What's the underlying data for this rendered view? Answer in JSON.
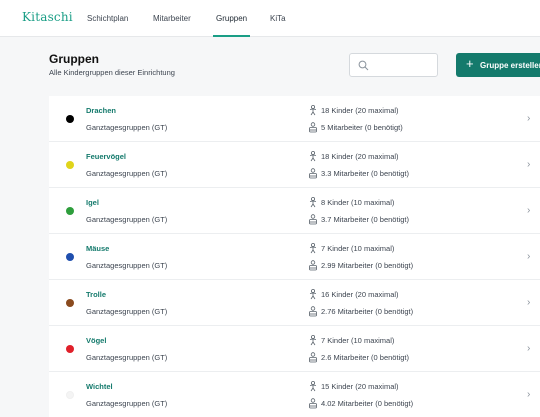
{
  "app": {
    "logo": "Kitaschi"
  },
  "nav": [
    {
      "label": "Schichtplan",
      "active": false
    },
    {
      "label": "Mitarbeiter",
      "active": false
    },
    {
      "label": "Gruppen",
      "active": true
    },
    {
      "label": "KiTa",
      "active": false
    }
  ],
  "header": {
    "title": "Gruppen",
    "subtitle": "Alle Kindergruppen dieser Einrichtung",
    "search_placeholder": "",
    "create_plus": "+",
    "create_label": "Gruppe erstellen"
  },
  "colors": {
    "accent": "#1a9e86",
    "button": "#147a6c"
  },
  "groups": [
    {
      "name": "Drachen",
      "type": "Ganztagesgruppen (GT)",
      "kids": "18 Kinder  (20 maximal)",
      "staff": "5 Mitarbeiter (0 benötigt)",
      "color": "#000000"
    },
    {
      "name": "Feuervögel",
      "type": "Ganztagesgruppen (GT)",
      "kids": "18 Kinder  (20 maximal)",
      "staff": "3.3 Mitarbeiter (0 benötigt)",
      "color": "#e0d41a"
    },
    {
      "name": "Igel",
      "type": "Ganztagesgruppen (GT)",
      "kids": "8 Kinder  (10 maximal)",
      "staff": "3.7 Mitarbeiter (0 benötigt)",
      "color": "#2e9e3c"
    },
    {
      "name": "Mäuse",
      "type": "Ganztagesgruppen (GT)",
      "kids": "7 Kinder  (10 maximal)",
      "staff": "2.99 Mitarbeiter (0 benötigt)",
      "color": "#1f4fae"
    },
    {
      "name": "Trolle",
      "type": "Ganztagesgruppen (GT)",
      "kids": "16 Kinder  (20 maximal)",
      "staff": "2.76 Mitarbeiter (0 benötigt)",
      "color": "#8a4a1e"
    },
    {
      "name": "Vögel",
      "type": "Ganztagesgruppen (GT)",
      "kids": "7 Kinder  (10 maximal)",
      "staff": "2.6 Mitarbeiter (0 benötigt)",
      "color": "#e0202a"
    },
    {
      "name": "Wichtel",
      "type": "Ganztagesgruppen (GT)",
      "kids": "15 Kinder  (20 maximal)",
      "staff": "4.02 Mitarbeiter (0 benötigt)",
      "color": "#f4f4f4"
    }
  ],
  "icons": {
    "search": "search-icon",
    "kids": "child-icon",
    "staff": "staff-icon",
    "chevron": "chevron-right-icon"
  },
  "chevron_glyph": "›"
}
